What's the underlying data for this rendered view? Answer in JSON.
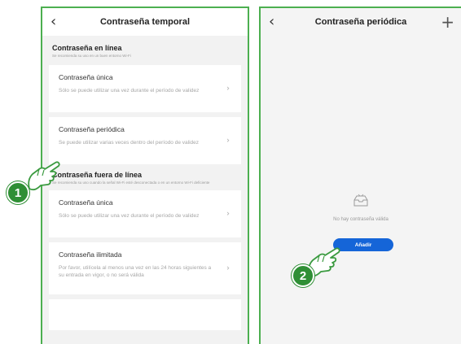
{
  "colors": {
    "frame": "#4caf50",
    "badge": "#2f8f35",
    "primary_button": "#1565d8"
  },
  "left_screen": {
    "back_icon": "chevron-left-icon",
    "title": "Contraseña temporal",
    "online": {
      "title": "Contraseña en línea",
      "note": "Se recomienda su uso en un buen entorno Wi-Fi",
      "items": [
        {
          "title": "Contraseña única",
          "desc": "Sólo se puede utilizar una vez durante el período de validez"
        },
        {
          "title": "Contraseña periódica",
          "desc": "Se puede utilizar varias veces dentro del período de validez"
        }
      ]
    },
    "offline": {
      "title": "Contraseña fuera de línea",
      "note": "Se recomienda su uso cuando la señal Wi-Fi esté desconectada o en un entorno Wi-Fi deficiente",
      "items": [
        {
          "title": "Contraseña única",
          "desc": "Sólo se puede utilizar una vez durante el período de validez"
        },
        {
          "title": "Contraseña ilimitada",
          "desc": "Por favor, utilícela al menos una vez en las 24 horas siguientes a su entrada en vigor, o no será válida"
        }
      ]
    }
  },
  "right_screen": {
    "back_icon": "chevron-left-icon",
    "title": "Contraseña periódica",
    "add_icon": "plus-icon",
    "empty_text": "No hay contraseña válida",
    "add_button": "Añadir"
  },
  "callouts": {
    "step1": "1",
    "step2": "2"
  }
}
